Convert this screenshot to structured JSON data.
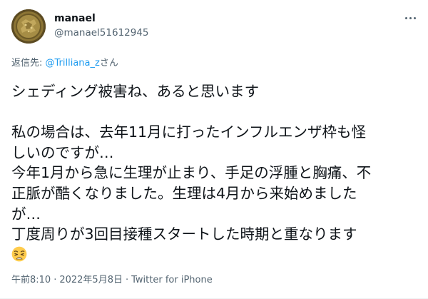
{
  "author": {
    "display_name": "manael",
    "handle": "@manael51612945",
    "avatar_icon": "gold-coin-avatar-icon"
  },
  "more_icon": "more-options-icon",
  "reply": {
    "prefix": "返信先: ",
    "mention": "@Trilliana_z",
    "suffix": "さん"
  },
  "body": {
    "line1": "シェディング被害ね、あると思います",
    "line2": "私の場合は、去年11月に打ったインフルエンザ枠も怪",
    "line3": "しいのですが…",
    "line4": "今年1月から急に生理が止まり、手足の浮腫と胸痛、不",
    "line5": "正脈が酷くなりました。生理は4月から来始めました",
    "line6": "が…",
    "line7": "丁度周りが3回目接種スタートした時期と重なります",
    "emoji": "weary-face-emoji"
  },
  "meta": {
    "time": "午前8:10",
    "separator": "·",
    "date": "2022年5月8日",
    "source": "Twitter for iPhone"
  },
  "colors": {
    "text": "#0f1419",
    "secondary": "#536471",
    "link": "#1d9bf0"
  }
}
